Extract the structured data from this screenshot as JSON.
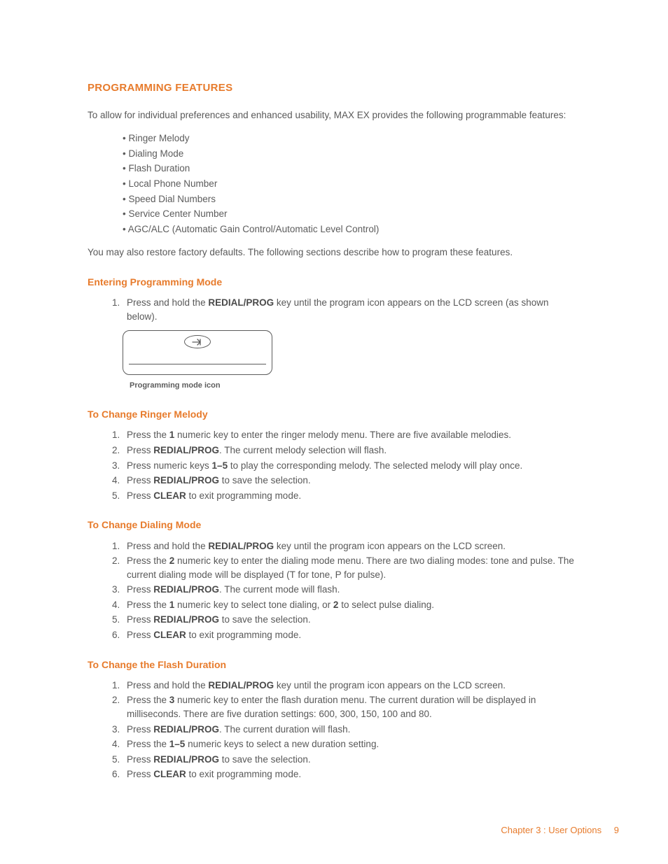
{
  "h1": "PROGRAMMING FEATURES",
  "intro": "To allow for individual preferences and enhanced usability, MAX EX provides the following programmable features:",
  "features": [
    "Ringer Melody",
    "Dialing Mode",
    "Flash Duration",
    "Local Phone Number",
    "Speed Dial Numbers",
    "Service Center Number",
    "AGC/ALC (Automatic Gain Control/Automatic Level Control)"
  ],
  "intro2": "You may also restore factory defaults. The following sections describe how to program these features.",
  "enter": {
    "title": "Entering Programming Mode",
    "step1_a": "Press and hold the ",
    "step1_b": "REDIAL/PROG",
    "step1_c": " key until the program icon appears on the LCD screen (as shown below).",
    "caption": "Programming mode icon"
  },
  "ringer": {
    "title": "To Change Ringer Melody",
    "s1a": "Press the ",
    "s1b": "1",
    "s1c": " numeric key to enter the ringer melody menu. There are five available melodies.",
    "s2a": "Press ",
    "s2b": "REDIAL/PROG",
    "s2c": ". The current melody selection will flash.",
    "s3a": "Press numeric keys ",
    "s3b": "1–5",
    "s3c": " to play the corresponding melody. The selected melody will play once.",
    "s4a": "Press ",
    "s4b": "REDIAL/PROG",
    "s4c": " to save the selection.",
    "s5a": "Press ",
    "s5b": "CLEAR",
    "s5c": " to exit programming mode."
  },
  "dial": {
    "title": "To Change Dialing Mode",
    "s1a": "Press and hold the ",
    "s1b": "REDIAL/PROG",
    "s1c": " key until the program icon appears on the LCD screen.",
    "s2a": "Press the ",
    "s2b": "2",
    "s2c": " numeric key to enter the dialing mode menu. There are two dialing modes: tone and pulse. The current dialing mode will be displayed (T for tone, P for pulse).",
    "s3a": "Press ",
    "s3b": "REDIAL/PROG",
    "s3c": ". The current mode will flash.",
    "s4a": "Press the ",
    "s4b": "1",
    "s4c": " numeric key to select tone dialing, or ",
    "s4d": "2",
    "s4e": " to select pulse dialing.",
    "s5a": "Press ",
    "s5b": "REDIAL/PROG",
    "s5c": " to save the selection.",
    "s6a": "Press ",
    "s6b": "CLEAR",
    "s6c": " to exit programming mode."
  },
  "flash": {
    "title": "To Change the Flash Duration",
    "s1a": "Press and hold the ",
    "s1b": "REDIAL/PROG",
    "s1c": " key until the program icon appears on the LCD screen.",
    "s2a": "Press the ",
    "s2b": "3",
    "s2c": " numeric key to enter the flash duration menu. The current duration will be displayed in milliseconds. There are five duration settings: 600, 300, 150, 100 and 80.",
    "s3a": "Press ",
    "s3b": "REDIAL/PROG",
    "s3c": ". The current duration will flash.",
    "s4a": "Press the ",
    "s4b": "1–5",
    "s4c": " numeric keys to select a new duration setting.",
    "s5a": "Press ",
    "s5b": "REDIAL/PROG",
    "s5c": " to save the selection.",
    "s6a": "Press ",
    "s6b": "CLEAR",
    "s6c": " to exit programming mode."
  },
  "footer": {
    "chapter": "Chapter 3 : User Options",
    "page": "9"
  }
}
